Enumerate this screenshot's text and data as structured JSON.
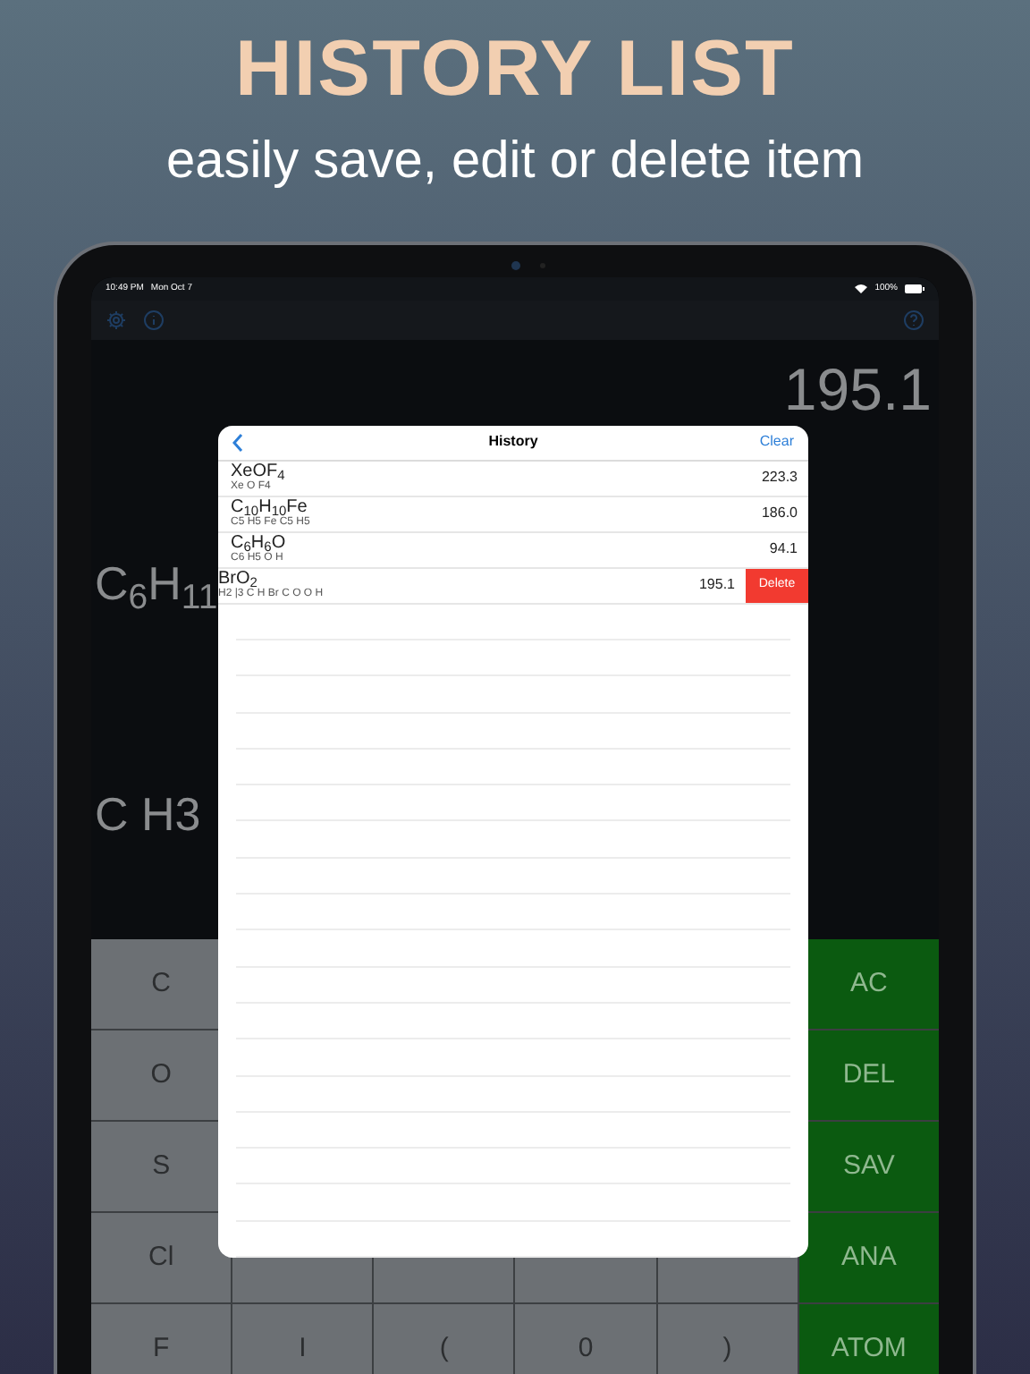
{
  "promo": {
    "title": "HISTORY LIST",
    "subtitle": "easily save, edit or delete item"
  },
  "status_bar": {
    "time": "10:49 PM",
    "date": "Mon Oct 7",
    "battery": "100%"
  },
  "display": {
    "result": "195.1",
    "formula": "C$_{6}$H$_{11}$",
    "expression": "C H3"
  },
  "keypad": [
    [
      {
        "kind": "element",
        "label": "C"
      },
      {
        "kind": "function",
        "label": "AC"
      }
    ],
    [
      {
        "kind": "element",
        "label": "O"
      },
      {
        "kind": "function",
        "label": "DEL"
      }
    ],
    [
      {
        "kind": "element",
        "label": "S"
      },
      {
        "kind": "function",
        "label": "SAV"
      }
    ],
    [
      {
        "kind": "element",
        "label": "Cl"
      },
      {
        "kind": "element"
      },
      {
        "kind": "element"
      },
      {
        "kind": "element"
      },
      {
        "kind": "element"
      },
      {
        "kind": "function",
        "label": "ANA"
      }
    ],
    [
      {
        "kind": "element",
        "label": "F"
      },
      {
        "kind": "element",
        "label": "I"
      },
      {
        "kind": "element",
        "label": "("
      },
      {
        "kind": "element",
        "label": "0"
      },
      {
        "kind": "element",
        "label": ")"
      },
      {
        "kind": "function",
        "label": "ATOM"
      }
    ]
  ],
  "history": {
    "title": "History",
    "clear": "Clear",
    "delete_label": "Delete",
    "rows": [
      {
        "formula": "XeOF$_{4}$",
        "expanded": "Xe O F4",
        "mass": "223.3",
        "swiped": false
      },
      {
        "formula": "C$_{10}$H$_{10}$Fe",
        "expanded": "C5 H5 Fe C5 H5",
        "mass": "186.0",
        "swiped": false
      },
      {
        "formula": "C$_{6}$H$_{6}$O",
        "expanded": "C6 H5 O H",
        "mass": "94.1",
        "swiped": false
      },
      {
        "formula": "BrO$_{2}$",
        "expanded": "H2 |3 C H Br C O O H",
        "mass": "195.1",
        "swiped": true
      }
    ]
  }
}
